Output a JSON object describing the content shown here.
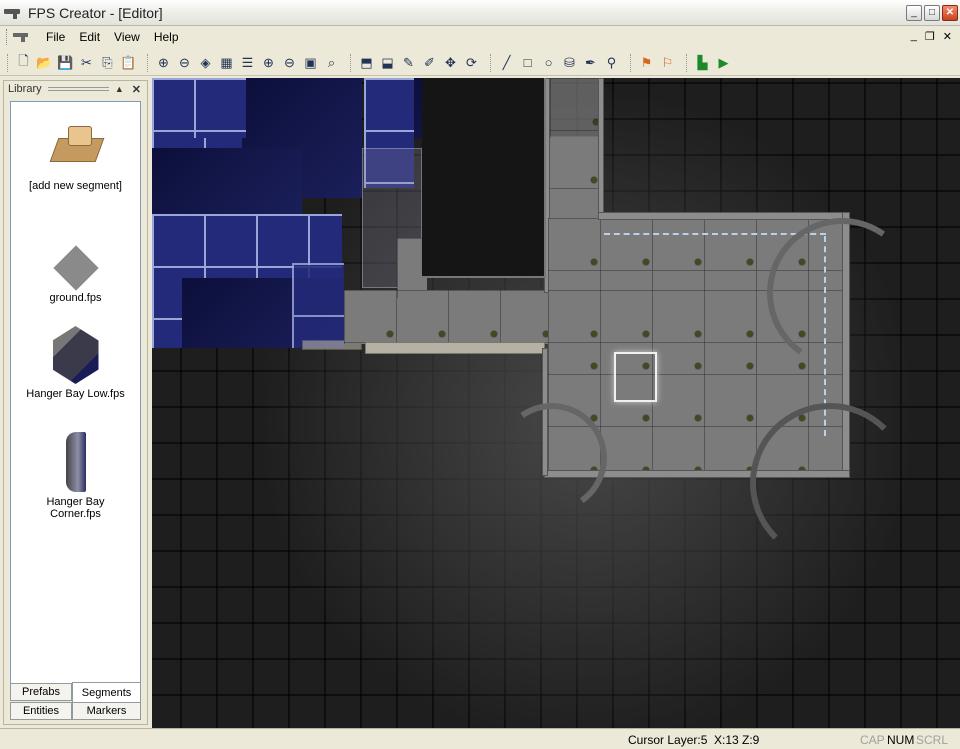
{
  "window": {
    "title": "FPS Creator - [Editor]",
    "controls": {
      "minimize": "_",
      "maximize": "□",
      "close": "✕"
    }
  },
  "menubar": {
    "items": [
      "File",
      "Edit",
      "View",
      "Help"
    ],
    "mdi_controls": {
      "minimize": "_",
      "restore": "❐",
      "close": "✕"
    }
  },
  "toolbar": {
    "groups": [
      [
        "new-file-icon",
        "open-folder-icon",
        "save-icon",
        "cut-icon",
        "copy-icon",
        "paste-icon"
      ],
      [
        "layer-up-icon",
        "layer-down-icon",
        "view-icon",
        "grid-icon",
        "layers-icon",
        "zoom-in-icon",
        "zoom-out-icon",
        "picture-icon",
        "magnify-icon"
      ],
      [
        "segment-paint-icon",
        "segment-pick-icon",
        "brush-icon",
        "spray-icon",
        "select-icon",
        "rotate-icon"
      ],
      [
        "line-icon",
        "rectangle-icon",
        "circle-icon",
        "fill-icon",
        "eyedropper-icon",
        "entity-icon"
      ],
      [
        "flag-icon",
        "flags-icon"
      ],
      [
        "test-level-icon",
        "build-game-icon"
      ]
    ]
  },
  "library": {
    "title": "Library",
    "items": [
      {
        "label": "[add new segment]",
        "icon": "add-segment-icon"
      },
      {
        "label": "ground.fps",
        "icon": "ground-segment-icon"
      },
      {
        "label": "Hanger Bay Low.fps",
        "icon": "hangar-bay-low-icon"
      },
      {
        "label": "Hanger Bay Corner.fps",
        "icon": "hangar-bay-corner-icon"
      }
    ],
    "tabs": [
      "Prefabs",
      "Segments",
      "Entities",
      "Markers"
    ],
    "active_tab": "Segments"
  },
  "status": {
    "cursor_layer": "Cursor Layer:5",
    "coords": "X:13  Z:9",
    "cap": "CAP",
    "num": "NUM",
    "scrl": "SCRL"
  },
  "colors": {
    "accent_blue": "#242a7a",
    "floor_gray": "#7b7b7b",
    "viewport_bg": "#1e1e1e"
  }
}
